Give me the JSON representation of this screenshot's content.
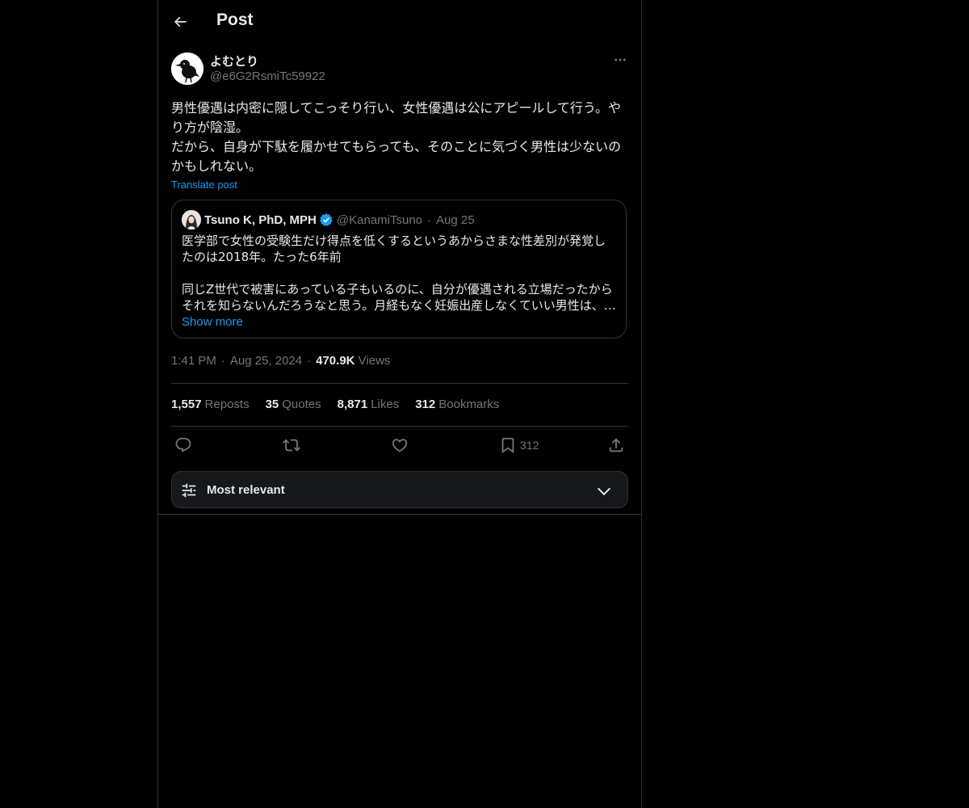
{
  "header": {
    "title": "Post"
  },
  "post": {
    "author_name": "よむとり",
    "author_handle": "@e6G2RsmiTc59922",
    "text": "男性優遇は内密に隠してこっそり行い、女性優遇は公にアピールして行う。やり方が陰湿。\nだから、自身が下駄を履かせてもらっても、そのことに気づく男性は少ないのかもしれない。",
    "translate_label": "Translate post",
    "time": "1:41 PM",
    "date": "Aug 25, 2024",
    "views_count": "470.9K",
    "views_label": "Views"
  },
  "quote": {
    "name": "Tsuno K, PhD, MPH",
    "handle": "@KanamiTsuno",
    "date": "Aug 25",
    "text": "医学部で女性の受験生だけ得点を低くするというあからさまな性差別が発覚したのは2018年。たった6年前\n\n同じZ世代で被害にあっている子もいるのに、自分が優遇される立場だったからそれを知らないんだろうなと思う。月経もなく妊娠出産しなくていい男性は、…",
    "show_more": "Show more"
  },
  "stats": {
    "reposts_count": "1,557",
    "reposts_label": "Reposts",
    "quotes_count": "35",
    "quotes_label": "Quotes",
    "likes_count": "8,871",
    "likes_label": "Likes",
    "bookmarks_count": "312",
    "bookmarks_label": "Bookmarks"
  },
  "actions": {
    "bookmark_count": "312",
    "icons": [
      "reply-icon",
      "repost-icon",
      "like-icon",
      "bookmark-icon",
      "share-icon"
    ]
  },
  "sort": {
    "label": "Most relevant"
  },
  "colors": {
    "background": "#000000",
    "text": "#e7e9ea",
    "muted": "#71767b",
    "accent": "#1d9bf0",
    "border": "#2f3336"
  }
}
